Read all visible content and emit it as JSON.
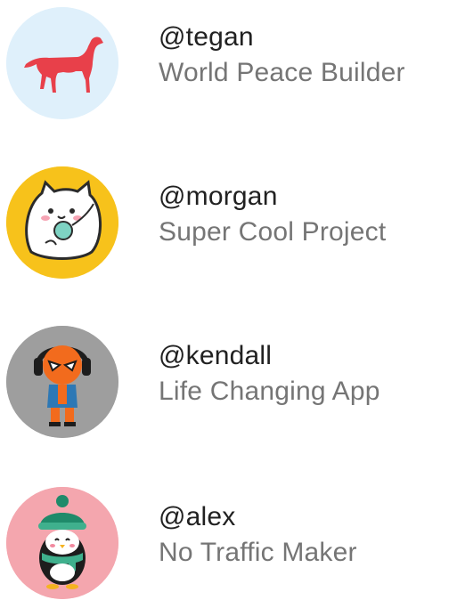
{
  "list": {
    "items": [
      {
        "handle": "@tegan",
        "subtitle": "World Peace Builder",
        "avatar": "dog-avatar-icon",
        "avatar_bg": "#dff0fb"
      },
      {
        "handle": "@morgan",
        "subtitle": "Super Cool Project",
        "avatar": "cat-avatar-icon",
        "avatar_bg": "#f7c21b"
      },
      {
        "handle": "@kendall",
        "subtitle": "Life Changing App",
        "avatar": "superhero-avatar-icon",
        "avatar_bg": "#9e9e9e"
      },
      {
        "handle": "@alex",
        "subtitle": "No Traffic Maker",
        "avatar": "penguin-avatar-icon",
        "avatar_bg": "#f4a6ae"
      }
    ]
  },
  "colors": {
    "handle_text": "#212121",
    "subtitle_text": "#757575"
  }
}
